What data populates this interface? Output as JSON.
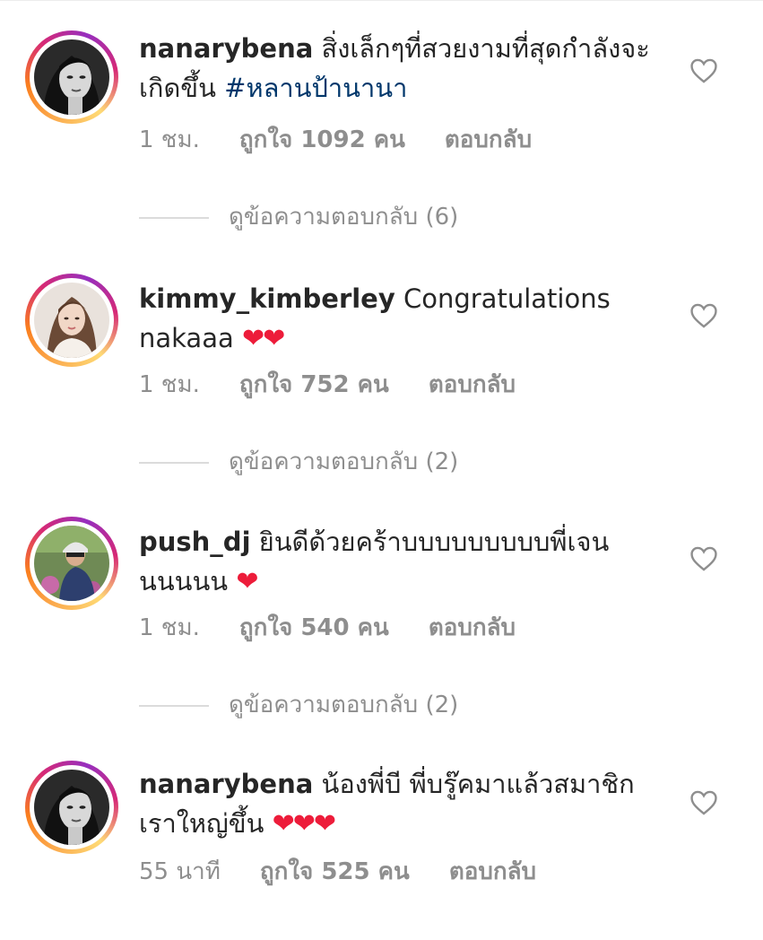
{
  "comments": [
    {
      "username": "nanarybena",
      "text": " สิ่งเล็กๆที่สวยงามที่สุดกำลังจะเกิดขึ้น ",
      "hashtag": "#หลานป้านานา",
      "hearts": "",
      "time": "1 ชม.",
      "likes": "ถูกใจ 1092 คน",
      "reply": "ตอบกลับ",
      "view_replies": "ดูข้อความตอบกลับ (6)",
      "avatar": "woman-bw-portrait"
    },
    {
      "username": "kimmy_kimberley",
      "text": " Congratulations nakaaa ",
      "hashtag": "",
      "hearts": "❤❤",
      "time": "1 ชม.",
      "likes": "ถูกใจ 752 คน",
      "reply": "ตอบกลับ",
      "view_replies": "ดูข้อความตอบกลับ (2)",
      "avatar": "woman-color-portrait"
    },
    {
      "username": "push_dj",
      "text": " ยินดีด้วยคร้าบบบบบบบบบพี่เจนนนนนน ",
      "hashtag": "",
      "hearts": "❤",
      "time": "1 ชม.",
      "likes": "ถูกใจ 540 คน",
      "reply": "ตอบกลับ",
      "view_replies": "ดูข้อความตอบกลับ (2)",
      "avatar": "man-cyclist"
    },
    {
      "username": "nanarybena",
      "text": " น้องพี่บี พี่บรู๊คมาแล้วสมาชิกเราใหญ่ขึ้น ",
      "hashtag": "",
      "hearts": "❤❤❤",
      "time": "55 นาที",
      "likes": "ถูกใจ 525 คน",
      "reply": "ตอบกลับ",
      "view_replies": "",
      "avatar": "woman-bw-portrait"
    }
  ],
  "colors": {
    "username": "#262626",
    "hashtag": "#00376b",
    "meta": "#8e8e8e",
    "heart_emoji": "#ed1c3a"
  },
  "icons": [
    "heart-outline-icon"
  ]
}
